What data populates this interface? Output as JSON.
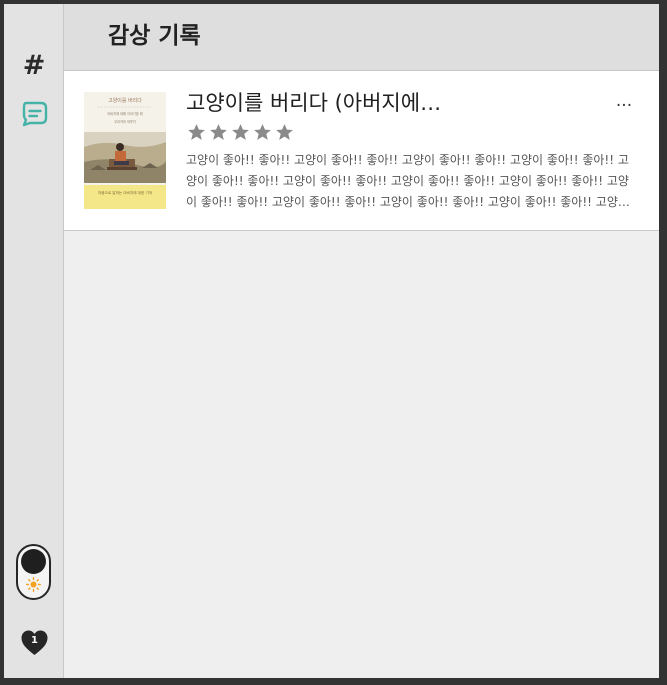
{
  "header": {
    "title": "감상 기록"
  },
  "sidebar": {
    "nav_items": [
      {
        "icon": "hash-icon",
        "label": "#"
      },
      {
        "icon": "review-icon",
        "label": ""
      }
    ],
    "theme_toggle": {
      "mode": "light",
      "icon": "sun-icon"
    },
    "like_badge": {
      "icon": "heart-icon",
      "count": "1"
    }
  },
  "reviews": [
    {
      "title": "고양이를 버리다 (아버지에…",
      "rating": 5,
      "rating_max": 5,
      "excerpt": "고양이 좋아!! 좋아!! 고양이 좋아!! 좋아!! 고양이 좋아!! 좋아!! 고양이 좋아!! 좋아!! 고양이 좋아!! 좋아!! 고양이 좋아!! 좋아!! 고양이 좋아!! 좋아!! 고양이 좋아!! 좋아!! 고양이 좋아!! 좋아!! 고양이 좋아!! 좋아!! 고양이 좋아!! 좋아!! 고양이 좋아!! 좋아!! 고양…",
      "more_label": "···",
      "cover": {
        "title": "고양이를 버리다",
        "blurb": "아버지에 대해 이야기할 때",
        "tagline": "무라카미 하루키",
        "band_text": "처음으로 말하는 아버지에 대한 기억",
        "band_color": "#f3e78a"
      }
    }
  ],
  "colors": {
    "accent": "#46b3a8",
    "star": "#8a8a8a",
    "sidebar_bg": "#e3e3e3",
    "header_bg": "#dedede",
    "content_bg": "#efefef"
  }
}
